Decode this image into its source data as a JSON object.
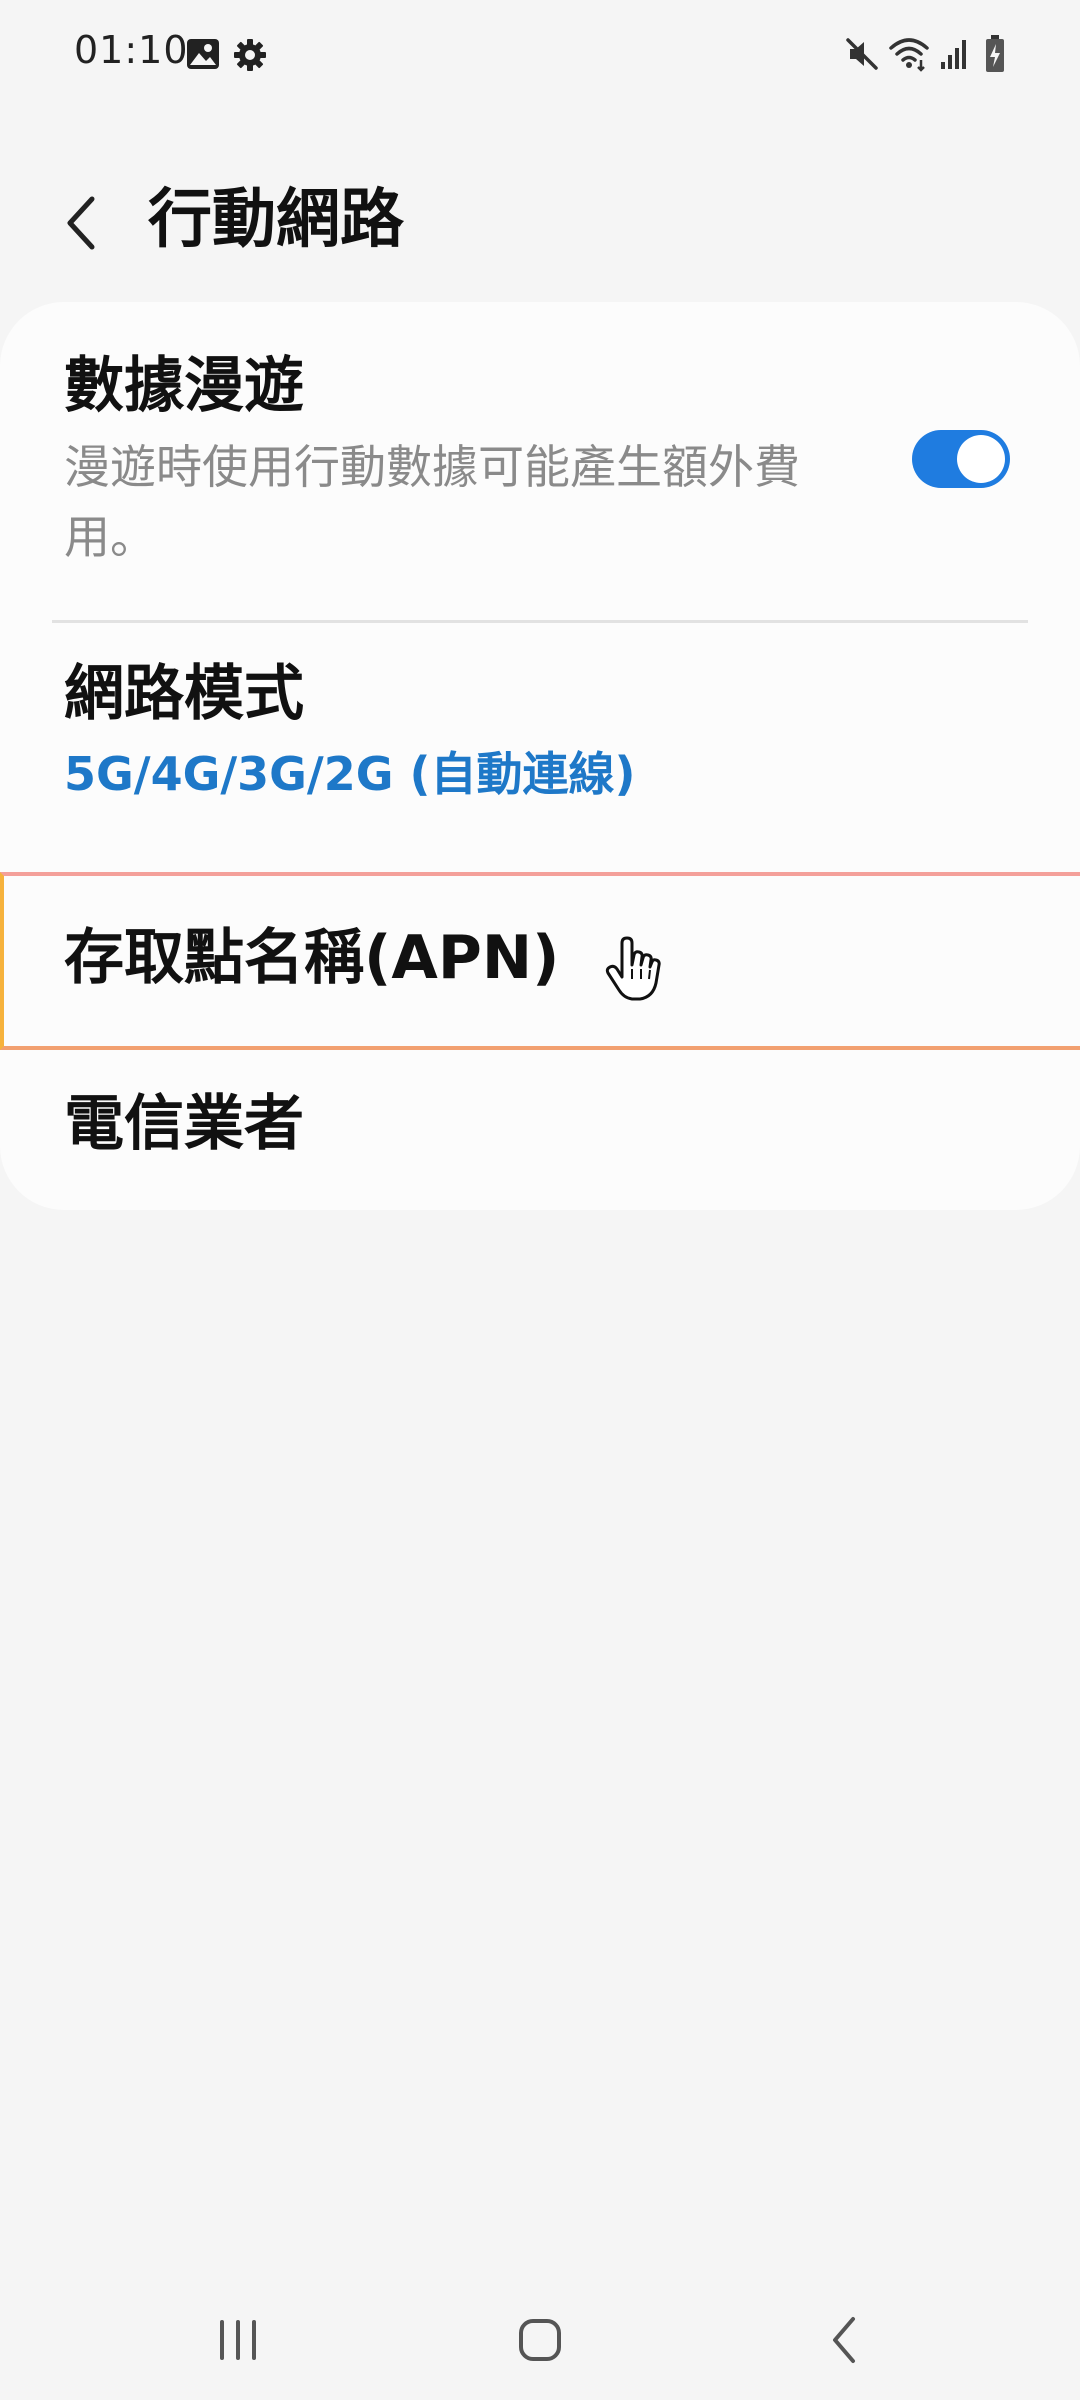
{
  "status_bar": {
    "time": "01:10",
    "icons": [
      "gallery-icon",
      "settings-icon",
      "mute-icon",
      "wifi-icon",
      "signal-icon",
      "battery-charging-icon"
    ]
  },
  "header": {
    "title": "行動網路",
    "back_icon": "chevron-left-icon"
  },
  "settings": {
    "data_roaming": {
      "title": "數據漫遊",
      "subtitle": "漫遊時使用行動數據可能產生額外費用。",
      "enabled": true
    },
    "network_mode": {
      "title": "網路模式",
      "value": "5G/4G/3G/2G (自動連線)"
    },
    "apn": {
      "title": "存取點名稱(APN)"
    },
    "carriers": {
      "title": "電信業者"
    }
  },
  "nav_bar": {
    "buttons": [
      "recent-apps-icon",
      "home-icon",
      "back-icon"
    ]
  },
  "colors": {
    "accent": "#1f7ce0",
    "value_text": "#1e78c8",
    "background": "#f5f5f5",
    "card": "#fcfcfc"
  }
}
